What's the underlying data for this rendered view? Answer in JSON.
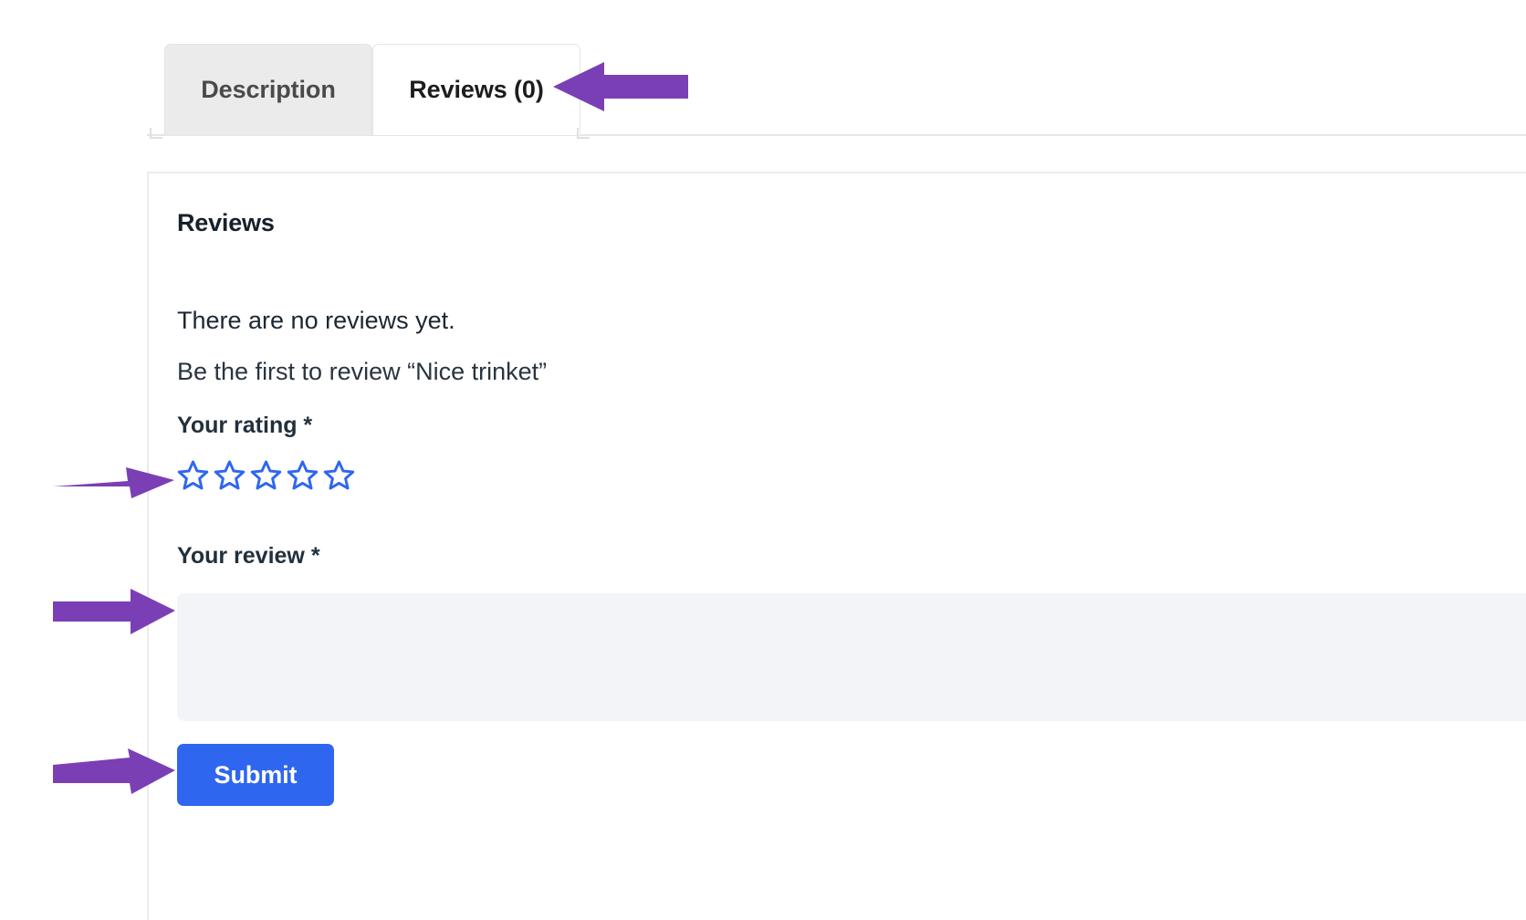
{
  "tabs": [
    {
      "id": "description",
      "label": "Description",
      "active": false
    },
    {
      "id": "reviews",
      "label": "Reviews (0)",
      "active": true
    }
  ],
  "panel": {
    "heading": "Reviews",
    "no_reviews_text": "There are no reviews yet.",
    "be_first_text": "Be the first to review “Nice trinket”",
    "rating": {
      "label": "Your rating *",
      "stars_total": 5,
      "stars_selected": 0,
      "star_color": "#2f66f0"
    },
    "review": {
      "label": "Your review *",
      "value": "",
      "placeholder": ""
    },
    "submit_label": "Submit"
  },
  "annotations": {
    "color": "#7b3fb5",
    "arrows": [
      {
        "id": "arrow-to-reviews-tab",
        "target": "Reviews (0)"
      },
      {
        "id": "arrow-to-star-rating",
        "target": "Your rating stars"
      },
      {
        "id": "arrow-to-review-textarea",
        "target": "Your review textarea"
      },
      {
        "id": "arrow-to-submit-button",
        "target": "Submit"
      }
    ]
  },
  "colors": {
    "accent_blue": "#2f66f0",
    "tab_inactive_bg": "#ebebeb",
    "textarea_bg": "#f3f4f8",
    "border": "#e6e6e6",
    "annotation_purple": "#7b3fb5"
  }
}
